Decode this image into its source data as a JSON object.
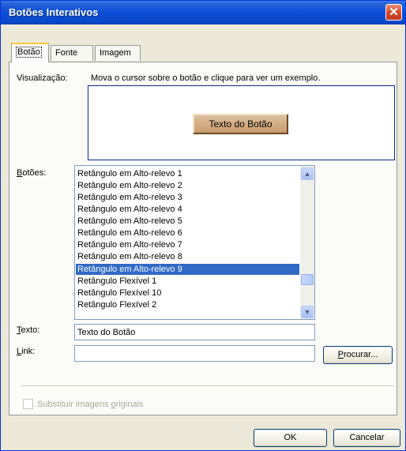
{
  "window": {
    "title": "Botões Interativos",
    "close_glyph": "✕"
  },
  "tabs": [
    {
      "label": "Botão",
      "active": true
    },
    {
      "label": "Fonte",
      "active": false
    },
    {
      "label": "Imagem",
      "active": false
    }
  ],
  "preview": {
    "label": "Visualização:",
    "instruction": "Mova o cursor sobre o botão e clique para ver um exemplo.",
    "sample_button_text": "Texto do Botão"
  },
  "buttons_list": {
    "label_prefix": "",
    "label_underlined": "B",
    "label_rest": "otões:",
    "items": [
      "Retângulo em Alto-relevo 1",
      "Retângulo em Alto-relevo 2",
      "Retângulo em Alto-relevo 3",
      "Retângulo em Alto-relevo 4",
      "Retângulo em Alto-relevo 5",
      "Retângulo em Alto-relevo 6",
      "Retângulo em Alto-relevo 7",
      "Retângulo em Alto-relevo 8",
      "Retângulo em Alto-relevo 9",
      "Retângulo Flexível 1",
      "Retângulo Flexível 10",
      "Retângulo Flexível 2"
    ],
    "selected_index": 8
  },
  "text_field": {
    "label_underlined": "T",
    "label_rest": "exto:",
    "value": "Texto do Botão"
  },
  "link_field": {
    "label_underlined": "L",
    "label_rest": "ink:",
    "value": ""
  },
  "browse_button": {
    "underlined": "P",
    "rest": "rocurar..."
  },
  "replace_images": {
    "label_prefix": "Substituir imagens ",
    "label_underlined": "o",
    "label_rest": "riginais",
    "checked": false,
    "enabled": false
  },
  "footer": {
    "ok_label": "OK",
    "cancel_label": "Cancelar"
  },
  "colors": {
    "title_bar": "#0a4ed6",
    "selection": "#316ac5",
    "sample_button": "#c99b6c"
  }
}
